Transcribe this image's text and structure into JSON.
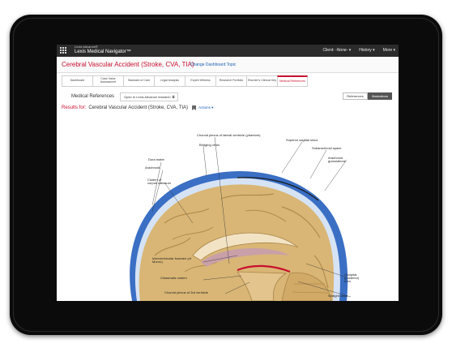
{
  "app": {
    "brand_small": "Lexis Advance®",
    "brand_main": "Lexis Medical Navigator™"
  },
  "topnav": {
    "client_label": "Client:",
    "client_value": "-None-",
    "history_label": "History ▾",
    "more_label": "More ▾"
  },
  "header": {
    "title": "Cerebral Vascular Accident (Stroke, CVA, TIA)",
    "change_topic": "Change Dashboard Topic"
  },
  "tabs": [
    {
      "label": "Dashboard"
    },
    {
      "label": "Case Value Assessment"
    },
    {
      "label": "Standard of Care"
    },
    {
      "label": "Legal Analysis"
    },
    {
      "label": "Expert Witness"
    },
    {
      "label": "Research Portfolio"
    },
    {
      "label": "Elsevier's Clinical Key"
    },
    {
      "label": "Medical References"
    }
  ],
  "section": {
    "title": "Medical References",
    "open_button": "Open in Lexis Advance research",
    "toggle_references": "References",
    "toggle_illustrations": "Illustrations"
  },
  "results": {
    "label": "Results for:",
    "query": "Cerebral Vascular Accident (Stroke, CVA, TIA)",
    "actions": "Actions ▾"
  },
  "figure_labels": {
    "choroid_plexus_lateral": "Choroid plexus of lateral ventricle (phantom)",
    "bridging_veins": "Bridging veins",
    "dura_mater": "Dura mater",
    "arachnoid": "Arachnoid",
    "cistern": "Cistern of corpus callosum",
    "superior_sagittal": "Superior sagittal sinus",
    "subarachnoid": "Subarachnoid space",
    "granulations": "Arachnoid granulations",
    "interventricular": "Interventricular foramen (of Monro)",
    "chiasmatic": "Chiasmatic cistern",
    "choroid_3rd": "Choroid plexus of 3rd ventricle",
    "occipital": "Occipital (posterior) horn",
    "straight_sinus": "Straight sinus"
  },
  "colors": {
    "accent": "#c8102e",
    "link": "#1a5fb4",
    "topbar": "#2b2b2b",
    "dura_blue": "#3a6fc4",
    "brain_tan": "#d9b675"
  },
  "icons": {
    "apps": "apps-grid-icon",
    "bookmark": "bookmark-icon",
    "external": "external-link-icon"
  }
}
